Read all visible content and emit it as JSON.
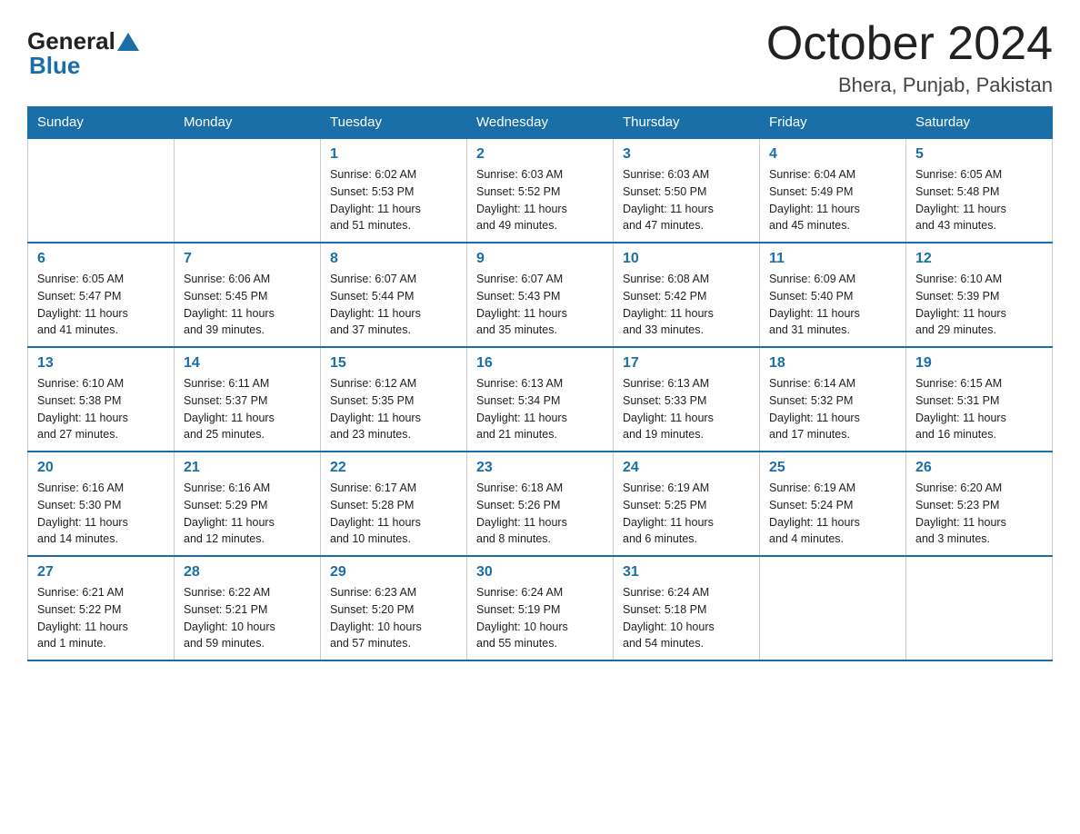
{
  "header": {
    "logo": {
      "general": "General",
      "blue": "Blue"
    },
    "title": "October 2024",
    "location": "Bhera, Punjab, Pakistan"
  },
  "calendar": {
    "weekdays": [
      "Sunday",
      "Monday",
      "Tuesday",
      "Wednesday",
      "Thursday",
      "Friday",
      "Saturday"
    ],
    "weeks": [
      [
        {
          "day": "",
          "info": ""
        },
        {
          "day": "",
          "info": ""
        },
        {
          "day": "1",
          "info": "Sunrise: 6:02 AM\nSunset: 5:53 PM\nDaylight: 11 hours\nand 51 minutes."
        },
        {
          "day": "2",
          "info": "Sunrise: 6:03 AM\nSunset: 5:52 PM\nDaylight: 11 hours\nand 49 minutes."
        },
        {
          "day": "3",
          "info": "Sunrise: 6:03 AM\nSunset: 5:50 PM\nDaylight: 11 hours\nand 47 minutes."
        },
        {
          "day": "4",
          "info": "Sunrise: 6:04 AM\nSunset: 5:49 PM\nDaylight: 11 hours\nand 45 minutes."
        },
        {
          "day": "5",
          "info": "Sunrise: 6:05 AM\nSunset: 5:48 PM\nDaylight: 11 hours\nand 43 minutes."
        }
      ],
      [
        {
          "day": "6",
          "info": "Sunrise: 6:05 AM\nSunset: 5:47 PM\nDaylight: 11 hours\nand 41 minutes."
        },
        {
          "day": "7",
          "info": "Sunrise: 6:06 AM\nSunset: 5:45 PM\nDaylight: 11 hours\nand 39 minutes."
        },
        {
          "day": "8",
          "info": "Sunrise: 6:07 AM\nSunset: 5:44 PM\nDaylight: 11 hours\nand 37 minutes."
        },
        {
          "day": "9",
          "info": "Sunrise: 6:07 AM\nSunset: 5:43 PM\nDaylight: 11 hours\nand 35 minutes."
        },
        {
          "day": "10",
          "info": "Sunrise: 6:08 AM\nSunset: 5:42 PM\nDaylight: 11 hours\nand 33 minutes."
        },
        {
          "day": "11",
          "info": "Sunrise: 6:09 AM\nSunset: 5:40 PM\nDaylight: 11 hours\nand 31 minutes."
        },
        {
          "day": "12",
          "info": "Sunrise: 6:10 AM\nSunset: 5:39 PM\nDaylight: 11 hours\nand 29 minutes."
        }
      ],
      [
        {
          "day": "13",
          "info": "Sunrise: 6:10 AM\nSunset: 5:38 PM\nDaylight: 11 hours\nand 27 minutes."
        },
        {
          "day": "14",
          "info": "Sunrise: 6:11 AM\nSunset: 5:37 PM\nDaylight: 11 hours\nand 25 minutes."
        },
        {
          "day": "15",
          "info": "Sunrise: 6:12 AM\nSunset: 5:35 PM\nDaylight: 11 hours\nand 23 minutes."
        },
        {
          "day": "16",
          "info": "Sunrise: 6:13 AM\nSunset: 5:34 PM\nDaylight: 11 hours\nand 21 minutes."
        },
        {
          "day": "17",
          "info": "Sunrise: 6:13 AM\nSunset: 5:33 PM\nDaylight: 11 hours\nand 19 minutes."
        },
        {
          "day": "18",
          "info": "Sunrise: 6:14 AM\nSunset: 5:32 PM\nDaylight: 11 hours\nand 17 minutes."
        },
        {
          "day": "19",
          "info": "Sunrise: 6:15 AM\nSunset: 5:31 PM\nDaylight: 11 hours\nand 16 minutes."
        }
      ],
      [
        {
          "day": "20",
          "info": "Sunrise: 6:16 AM\nSunset: 5:30 PM\nDaylight: 11 hours\nand 14 minutes."
        },
        {
          "day": "21",
          "info": "Sunrise: 6:16 AM\nSunset: 5:29 PM\nDaylight: 11 hours\nand 12 minutes."
        },
        {
          "day": "22",
          "info": "Sunrise: 6:17 AM\nSunset: 5:28 PM\nDaylight: 11 hours\nand 10 minutes."
        },
        {
          "day": "23",
          "info": "Sunrise: 6:18 AM\nSunset: 5:26 PM\nDaylight: 11 hours\nand 8 minutes."
        },
        {
          "day": "24",
          "info": "Sunrise: 6:19 AM\nSunset: 5:25 PM\nDaylight: 11 hours\nand 6 minutes."
        },
        {
          "day": "25",
          "info": "Sunrise: 6:19 AM\nSunset: 5:24 PM\nDaylight: 11 hours\nand 4 minutes."
        },
        {
          "day": "26",
          "info": "Sunrise: 6:20 AM\nSunset: 5:23 PM\nDaylight: 11 hours\nand 3 minutes."
        }
      ],
      [
        {
          "day": "27",
          "info": "Sunrise: 6:21 AM\nSunset: 5:22 PM\nDaylight: 11 hours\nand 1 minute."
        },
        {
          "day": "28",
          "info": "Sunrise: 6:22 AM\nSunset: 5:21 PM\nDaylight: 10 hours\nand 59 minutes."
        },
        {
          "day": "29",
          "info": "Sunrise: 6:23 AM\nSunset: 5:20 PM\nDaylight: 10 hours\nand 57 minutes."
        },
        {
          "day": "30",
          "info": "Sunrise: 6:24 AM\nSunset: 5:19 PM\nDaylight: 10 hours\nand 55 minutes."
        },
        {
          "day": "31",
          "info": "Sunrise: 6:24 AM\nSunset: 5:18 PM\nDaylight: 10 hours\nand 54 minutes."
        },
        {
          "day": "",
          "info": ""
        },
        {
          "day": "",
          "info": ""
        }
      ]
    ]
  }
}
